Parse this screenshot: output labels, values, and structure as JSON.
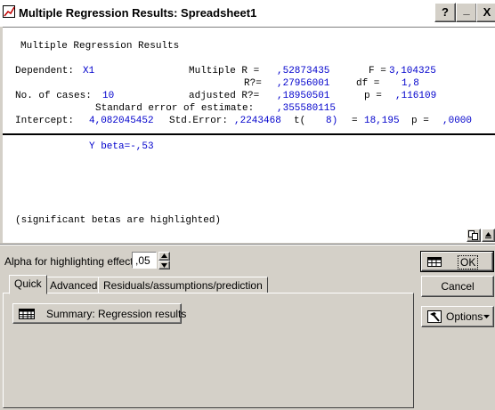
{
  "window": {
    "title": "Multiple Regression Results: Spreadsheet1",
    "help_btn": "?",
    "min_btn": "_",
    "close_btn": "X"
  },
  "results": {
    "heading": "Multiple Regression Results",
    "dependent_label": "Dependent:",
    "dependent_value": "X1",
    "multiple_r_label": "Multiple R =",
    "multiple_r_value": ",52873435",
    "f_label": "F =",
    "f_value": "3,104325",
    "r2_label": "R?=",
    "r2_value": ",27956001",
    "df_label": "df =",
    "df_value": "1,8",
    "cases_label": "No. of cases:",
    "cases_value": "10",
    "adj_r2_label": "adjusted R?=",
    "adj_r2_value": ",18950501",
    "p_label": "p =",
    "p_value": ",116109",
    "se_label": "Standard error of estimate:",
    "se_value": ",355580115",
    "intercept_label": "Intercept:",
    "intercept_value": "4,082045452",
    "stderr_label": "Std.Error:",
    "stderr_value": ",2243468",
    "t_label": "t(",
    "t_df": "8)",
    "t_eq": "=",
    "t_value": "18,195",
    "p2_label": "p =",
    "p2_value": ",0000",
    "beta_line": "Y beta=-,53",
    "note": "(significant betas are highlighted)"
  },
  "controls": {
    "alpha_label": "Alpha for highlighting effects:",
    "alpha_value": ",05",
    "ok_label": "OK",
    "cancel_label": "Cancel",
    "options_label": "Options",
    "tabs": [
      {
        "label": "Quick"
      },
      {
        "label": "Advanced"
      },
      {
        "label": "Residuals/assumptions/prediction"
      }
    ],
    "summary_label": "Summary:  Regression results"
  }
}
